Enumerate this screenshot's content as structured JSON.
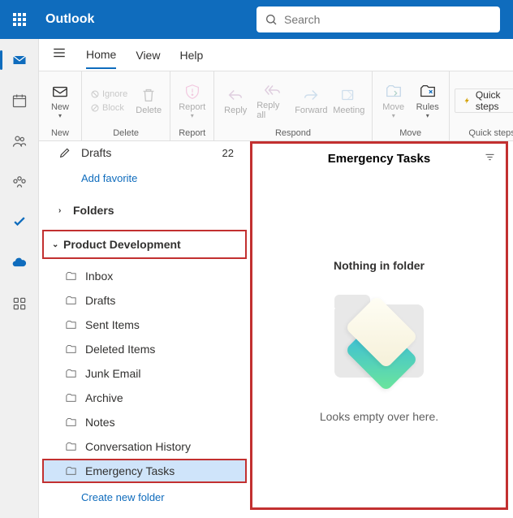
{
  "header": {
    "app_title": "Outlook",
    "search_placeholder": "Search"
  },
  "tabs": {
    "home": "Home",
    "view": "View",
    "help": "Help"
  },
  "ribbon": {
    "new": {
      "label": "New",
      "group": "New"
    },
    "delete": {
      "ignore": "Ignore",
      "block": "Block",
      "delete": "Delete",
      "group": "Delete"
    },
    "report": {
      "report": "Report",
      "group": "Report"
    },
    "respond": {
      "reply": "Reply",
      "reply_all": "Reply all",
      "forward": "Forward",
      "meeting": "Meeting",
      "group": "Respond"
    },
    "move": {
      "move": "Move",
      "rules": "Rules",
      "group": "Move"
    },
    "quick_steps": {
      "label": "Quick steps",
      "group": "Quick steps"
    }
  },
  "nav": {
    "drafts": {
      "label": "Drafts",
      "count": "22"
    },
    "add_favorite": "Add favorite",
    "folders": "Folders",
    "account": "Product Development",
    "items": [
      {
        "label": "Inbox"
      },
      {
        "label": "Drafts"
      },
      {
        "label": "Sent Items"
      },
      {
        "label": "Deleted Items"
      },
      {
        "label": "Junk Email"
      },
      {
        "label": "Archive"
      },
      {
        "label": "Notes"
      },
      {
        "label": "Conversation History"
      },
      {
        "label": "Emergency Tasks"
      }
    ],
    "create_folder": "Create new folder"
  },
  "view": {
    "title": "Emergency Tasks",
    "empty_title": "Nothing in folder",
    "empty_sub": "Looks empty over here."
  }
}
